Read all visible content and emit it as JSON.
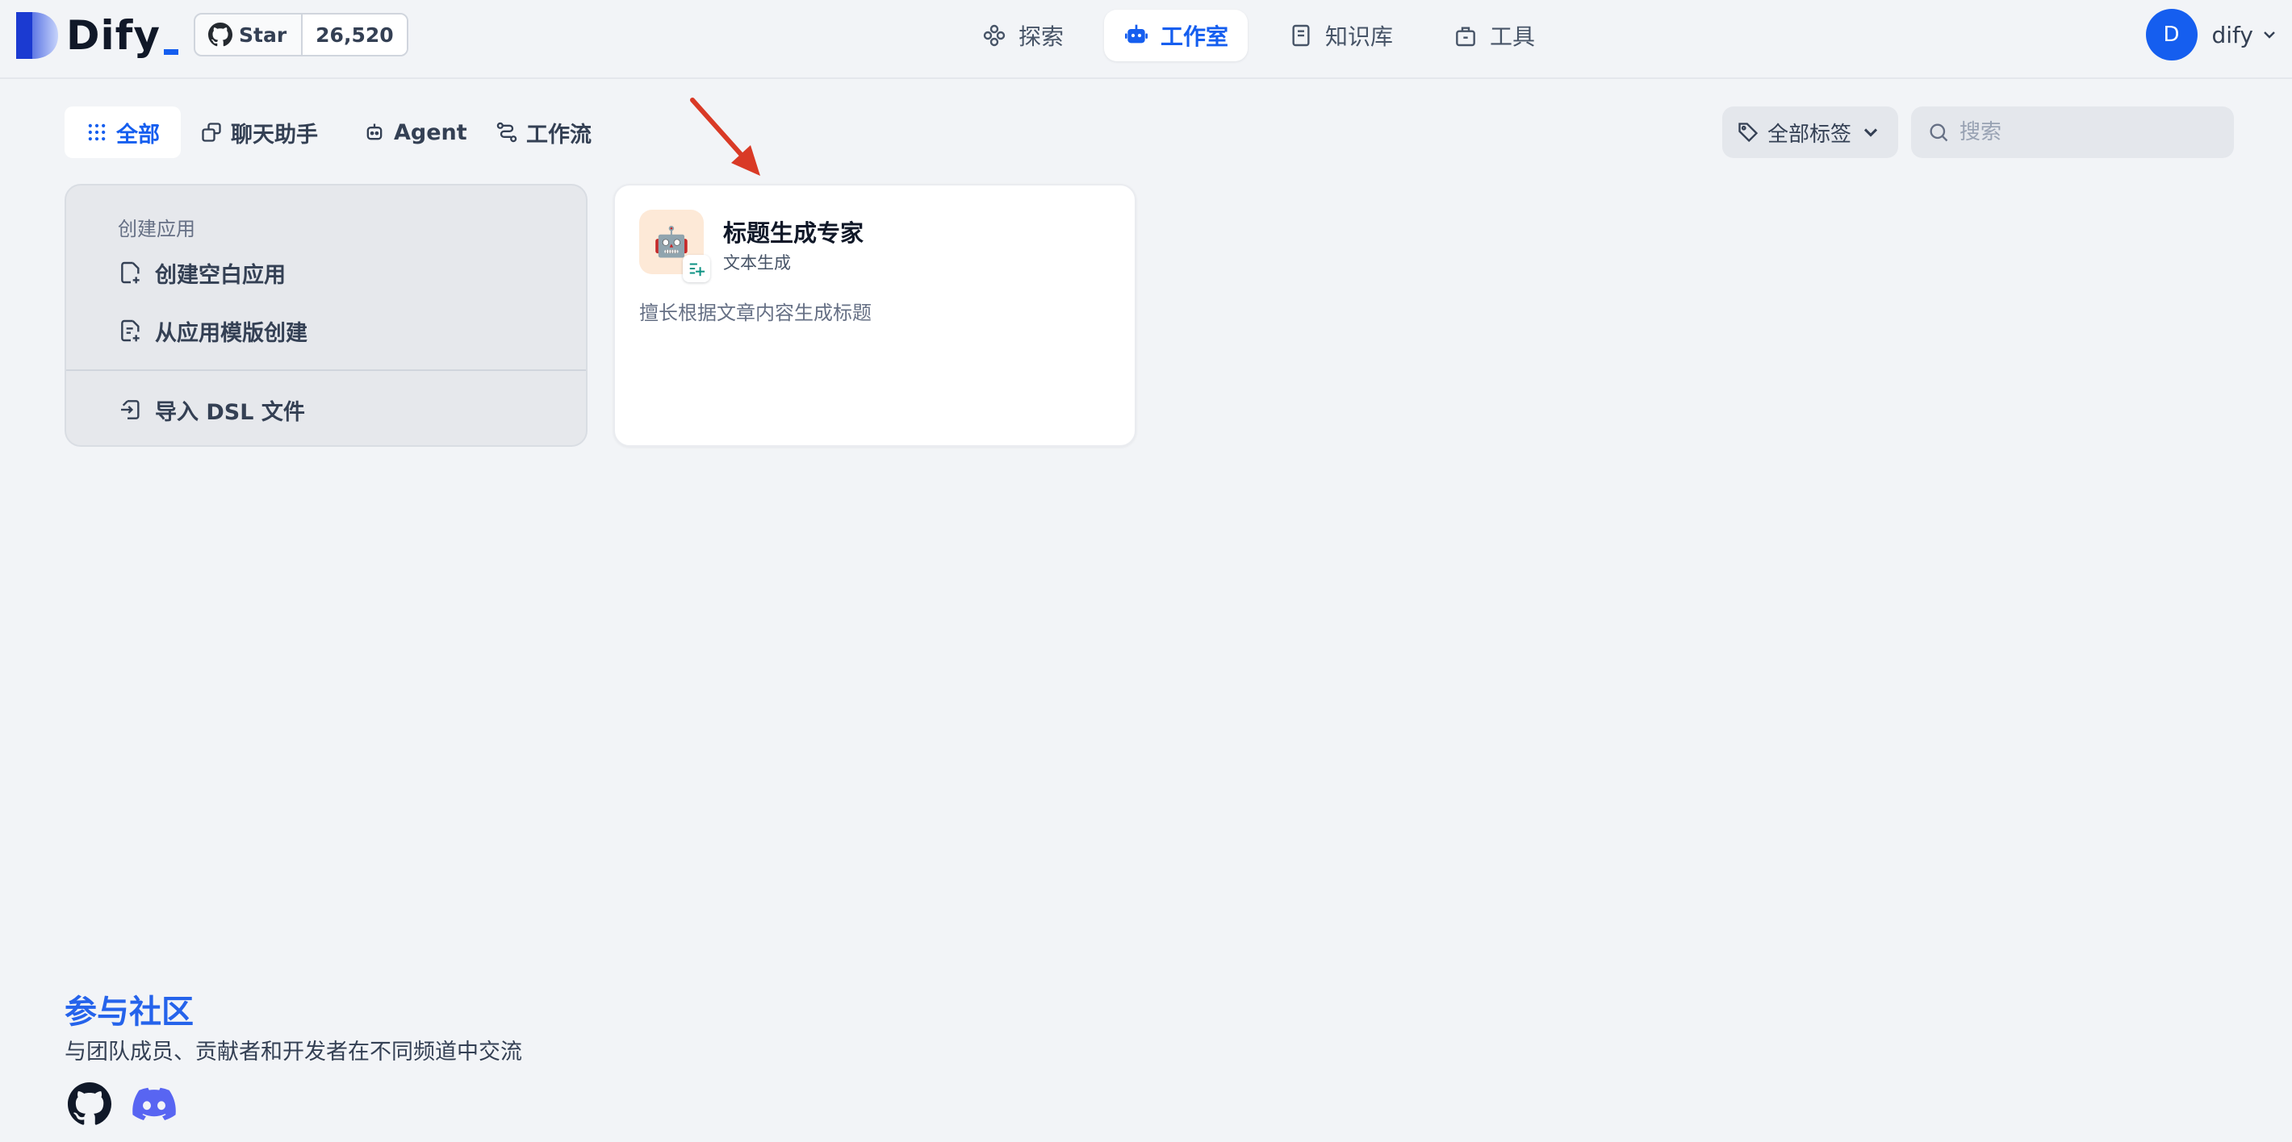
{
  "header": {
    "logo_text": "Dify",
    "github": {
      "star_label": "Star",
      "star_count": "26,520"
    },
    "nav": [
      {
        "label": "探索",
        "icon": "explore-icon"
      },
      {
        "label": "工作室",
        "icon": "robot-icon",
        "active": true
      },
      {
        "label": "知识库",
        "icon": "book-icon"
      },
      {
        "label": "工具",
        "icon": "toolbox-icon"
      }
    ],
    "user": {
      "avatar_letter": "D",
      "name": "dify"
    }
  },
  "filters": {
    "tabs": [
      {
        "label": "全部",
        "icon": "grid-icon",
        "active": true
      },
      {
        "label": "聊天助手",
        "icon": "chat-bot-icon"
      },
      {
        "label": "Agent",
        "icon": "agent-icon"
      },
      {
        "label": "工作流",
        "icon": "workflow-icon"
      }
    ],
    "tag_filter_label": "全部标签",
    "search_placeholder": "搜索"
  },
  "create_card": {
    "title": "创建应用",
    "items": [
      {
        "label": "创建空白应用",
        "icon": "file-plus-icon"
      },
      {
        "label": "从应用模版创建",
        "icon": "file-text-icon"
      },
      {
        "label": "导入 DSL 文件",
        "icon": "import-icon"
      }
    ]
  },
  "apps": [
    {
      "name": "标题生成专家",
      "type": "文本生成",
      "description": "擅长根据文章内容生成标题",
      "icon_emoji": "🤖",
      "icon_bg": "#fde9d7"
    }
  ],
  "community": {
    "title": "参与社区",
    "description": "与团队成员、贡献者和开发者在不同频道中交流",
    "links": [
      "github-icon",
      "discord-icon"
    ]
  },
  "colors": {
    "accent": "#155eef",
    "community_title": "#2563eb",
    "annotation_arrow": "#d93a26"
  }
}
